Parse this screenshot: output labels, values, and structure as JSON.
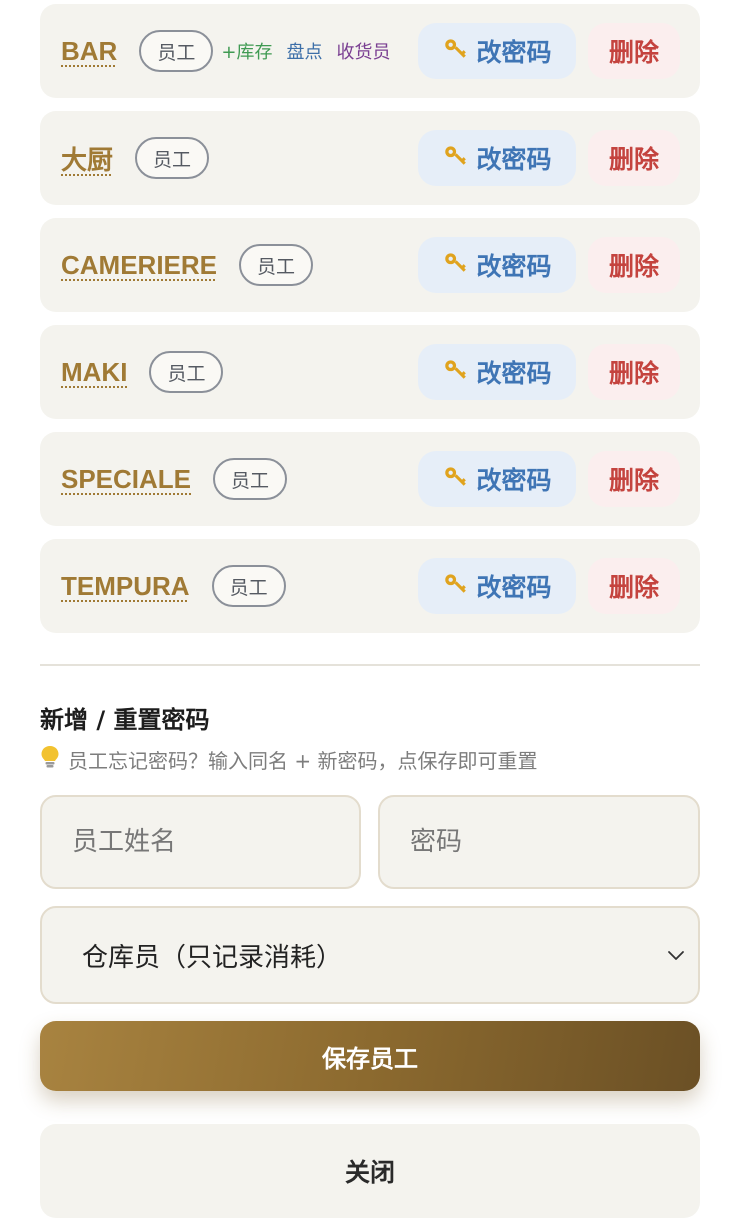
{
  "staff": [
    {
      "name": "BAR",
      "role": "员工",
      "perms": [
        {
          "label": "+库存",
          "color": "#3f9a52"
        },
        {
          "label": "盘点",
          "color": "#3d6fa8"
        },
        {
          "label": "收货员",
          "color": "#7a3f92"
        }
      ]
    },
    {
      "name": "大厨",
      "role": "员工",
      "perms": []
    },
    {
      "name": "CAMERIERE",
      "role": "员工",
      "perms": []
    },
    {
      "name": "MAKI",
      "role": "员工",
      "perms": []
    },
    {
      "name": "SPECIALE",
      "role": "员工",
      "perms": []
    },
    {
      "name": "TEMPURA",
      "role": "员工",
      "perms": []
    }
  ],
  "row_actions": {
    "change_password_label": "改密码",
    "change_password_icon": "key-icon",
    "delete_label": "删除"
  },
  "form": {
    "title": "新增 / 重置密码",
    "hint_icon": "lightbulb-icon",
    "hint": "员工忘记密码？输入同名 + 新密码，点保存即可重置",
    "name_placeholder": "员工姓名",
    "password_placeholder": "密码",
    "role_selected": "仓库员（只记录消耗）",
    "save_label": "保存员工",
    "close_label": "关闭"
  },
  "colors": {
    "accent_gold": "#a07a35",
    "password_button_text": "#3f75b5",
    "delete_button_text": "#c4433e",
    "row_background": "#f4f3ee"
  }
}
